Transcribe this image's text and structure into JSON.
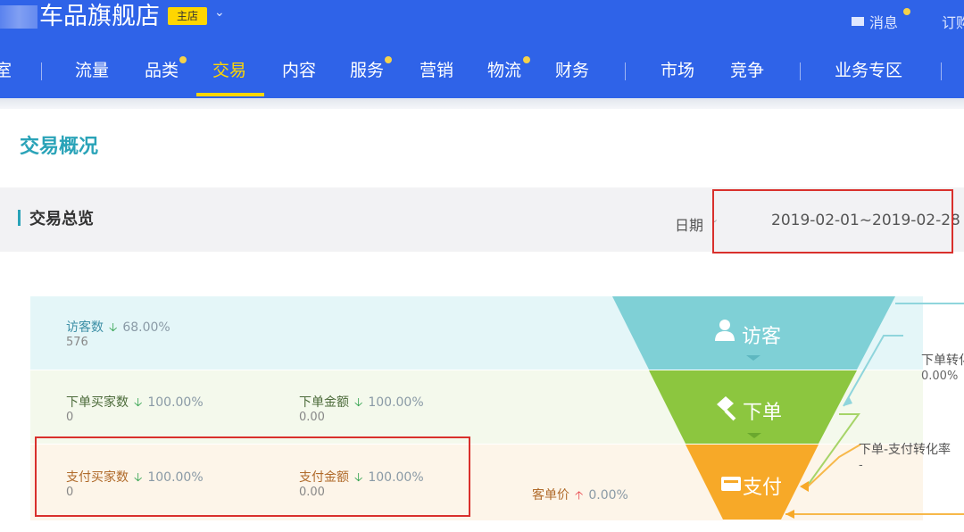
{
  "header": {
    "store_name": "车品旗舰店",
    "store_badge": "主店",
    "messages_label": "消息",
    "order_label": "订购"
  },
  "nav": {
    "items": [
      {
        "label": "流量"
      },
      {
        "label": "品类"
      },
      {
        "label": "交易"
      },
      {
        "label": "内容"
      },
      {
        "label": "服务"
      },
      {
        "label": "营销"
      },
      {
        "label": "物流"
      },
      {
        "label": "财务"
      },
      {
        "label": "市场"
      },
      {
        "label": "竞争"
      },
      {
        "label": "业务专区"
      }
    ],
    "active": "交易"
  },
  "page": {
    "title": "交易概况",
    "section_title": "交易总览",
    "date_label": "日期",
    "date_range": "2019-02-01~2019-02-28"
  },
  "funnel": {
    "visitor": {
      "label": "访客",
      "metric_label": "访客数",
      "change": "68.00%",
      "value": "576"
    },
    "order": {
      "label": "下单",
      "buyers_label": "下单买家数",
      "buyers_change": "100.00%",
      "buyers_value": "0",
      "amount_label": "下单金额",
      "amount_change": "100.00%",
      "amount_value": "0.00",
      "conversion_label": "下单转化率",
      "conversion_value": "0.00%"
    },
    "payment": {
      "label": "支付",
      "buyers_label": "支付买家数",
      "buyers_change": "100.00%",
      "buyers_value": "0",
      "amount_label": "支付金额",
      "amount_change": "100.00%",
      "amount_value": "0.00",
      "unit_price_label": "客单价",
      "unit_price_change": "0.00%",
      "conversion_label": "下单-支付转化率",
      "conversion_value": "-"
    }
  },
  "colors": {
    "brand_blue": "#2f63e8",
    "accent_yellow": "#ffd600",
    "visitor_teal": "#7fd0d6",
    "order_green": "#8cc63f",
    "payment_orange": "#f7a928",
    "highlight_red": "#d9302c"
  }
}
